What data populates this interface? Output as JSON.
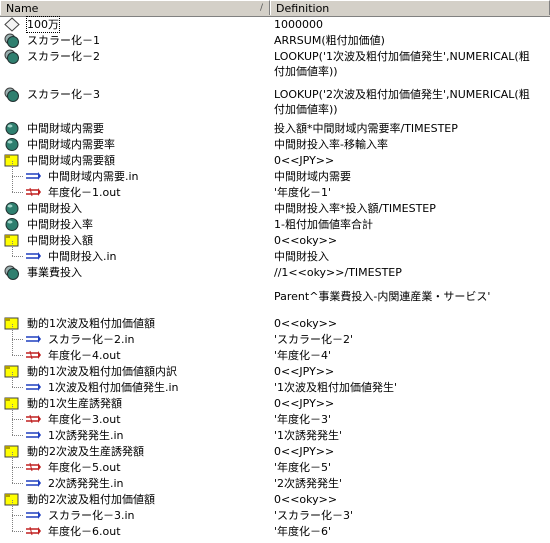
{
  "header": {
    "name": "Name",
    "definition": "Definition",
    "sort_glyph": "/"
  },
  "rows": [
    {
      "name": "100万",
      "def": [
        "1000000"
      ],
      "icon": "constant-diamond-icon",
      "indent": 0,
      "h": 15,
      "sel": true
    },
    {
      "name": "スカラー化－1",
      "def": [
        "ARRSUM(粗付加価値)"
      ],
      "icon": "converter-multi-icon",
      "indent": 0,
      "h": 15
    },
    {
      "name": "スカラー化－2",
      "def": [
        "LOOKUP('1次波及粗付加価値発生',NUMERICAL(粗",
        "付加価値率))"
      ],
      "icon": "converter-multi-icon",
      "indent": 0,
      "h": 30
    },
    {
      "name": "",
      "def": [],
      "icon": "",
      "indent": 0,
      "h": 6
    },
    {
      "name": "スカラー化－3",
      "def": [
        "LOOKUP('2次波及粗付加価値発生',NUMERICAL(粗",
        "付加価値率))"
      ],
      "icon": "converter-multi-icon",
      "indent": 0,
      "h": 30
    },
    {
      "name": "",
      "def": [],
      "icon": "",
      "indent": 0,
      "h": 2
    },
    {
      "name": "中間財域内需要",
      "def": [
        "投入額*中間財域内需要率/TIMESTEP"
      ],
      "icon": "converter-icon",
      "indent": 0,
      "h": 15
    },
    {
      "name": "中間財域内需要率",
      "def": [
        "中間財投入率-移輸入率"
      ],
      "icon": "converter-icon",
      "indent": 0,
      "h": 15
    },
    {
      "name": "中間財域内需要額",
      "def": [
        "0<<JPY>>"
      ],
      "icon": "stock-folder-icon",
      "indent": 0,
      "h": 15
    },
    {
      "name": "中間財域内需要.in",
      "def": [
        "中間財域内需要"
      ],
      "icon": "inflow-arrow-icon",
      "indent": 1,
      "h": 15
    },
    {
      "name": "年度化－1.out",
      "def": [
        "'年度化－1'"
      ],
      "icon": "outflow-arrow-icon",
      "indent": 1,
      "h": 15
    },
    {
      "name": "中間財投入",
      "def": [
        "中間財投入率*投入額/TIMESTEP"
      ],
      "icon": "converter-icon",
      "indent": 0,
      "h": 15
    },
    {
      "name": "中間財投入率",
      "def": [
        "1-粗付加価値率合計"
      ],
      "icon": "converter-icon",
      "indent": 0,
      "h": 15
    },
    {
      "name": "中間財投入額",
      "def": [
        "0<<oky>>"
      ],
      "icon": "stock-folder-icon",
      "indent": 0,
      "h": 15
    },
    {
      "name": "中間財投入.in",
      "def": [
        "中間財投入"
      ],
      "icon": "inflow-arrow-icon",
      "indent": 1,
      "h": 15
    },
    {
      "name": "事業費投入",
      "def": [
        "//1<<oky>>/TIMESTEP"
      ],
      "icon": "converter-multi-icon",
      "indent": 0,
      "h": 15
    },
    {
      "name": "",
      "def": [],
      "icon": "",
      "indent": 0,
      "h": 7
    },
    {
      "name": "",
      "def": [
        "Parent^事業費投入-内関連産業・サービス'"
      ],
      "icon": "",
      "indent": 0,
      "h": 15
    },
    {
      "name": "",
      "def": [],
      "icon": "",
      "indent": 0,
      "h": 10
    },
    {
      "name": "動的1次波及粗付加価値額",
      "def": [
        "0<<oky>>"
      ],
      "icon": "stock-folder-icon",
      "indent": 0,
      "h": 15
    },
    {
      "name": "スカラー化－2.in",
      "def": [
        "'スカラー化－2'"
      ],
      "icon": "inflow-arrow-icon",
      "indent": 1,
      "h": 15
    },
    {
      "name": "年度化－4.out",
      "def": [
        "'年度化－4'"
      ],
      "icon": "outflow-arrow-icon",
      "indent": 1,
      "h": 15
    },
    {
      "name": "動的1次波及粗付加価値額内訳",
      "def": [
        "0<<JPY>>"
      ],
      "icon": "stock-folder-icon",
      "indent": 0,
      "h": 15
    },
    {
      "name": "1次波及粗付加価値発生.in",
      "def": [
        "'1次波及粗付加価値発生'"
      ],
      "icon": "inflow-arrow-icon",
      "indent": 1,
      "h": 15
    },
    {
      "name": "動的1次生産誘発額",
      "def": [
        "0<<JPY>>"
      ],
      "icon": "stock-folder-icon",
      "indent": 0,
      "h": 15
    },
    {
      "name": "年度化－3.out",
      "def": [
        "'年度化－3'"
      ],
      "icon": "outflow-arrow-icon",
      "indent": 1,
      "h": 15
    },
    {
      "name": "1次誘発発生.in",
      "def": [
        "'1次誘発発生'"
      ],
      "icon": "inflow-arrow-icon",
      "indent": 1,
      "h": 15
    },
    {
      "name": "動的2次波及生産誘発額",
      "def": [
        "0<<JPY>>"
      ],
      "icon": "stock-folder-icon",
      "indent": 0,
      "h": 15
    },
    {
      "name": "年度化－5.out",
      "def": [
        "'年度化－5'"
      ],
      "icon": "outflow-arrow-icon",
      "indent": 1,
      "h": 15
    },
    {
      "name": "2次誘発発生.in",
      "def": [
        "'2次誘発発生'"
      ],
      "icon": "inflow-arrow-icon",
      "indent": 1,
      "h": 15
    },
    {
      "name": "動的2次波及粗付加価値額",
      "def": [
        "0<<oky>>"
      ],
      "icon": "stock-folder-icon",
      "indent": 0,
      "h": 15
    },
    {
      "name": "スカラー化－3.in",
      "def": [
        "'スカラー化－3'"
      ],
      "icon": "inflow-arrow-icon",
      "indent": 1,
      "h": 15
    },
    {
      "name": "年度化－6.out",
      "def": [
        "'年度化－6'"
      ],
      "icon": "outflow-arrow-icon",
      "indent": 1,
      "h": 15
    }
  ],
  "colors": {
    "inflow": "#1f3fbf",
    "outflow": "#c02020",
    "stock": "#ffff00",
    "converter": "#2f7f6f"
  }
}
